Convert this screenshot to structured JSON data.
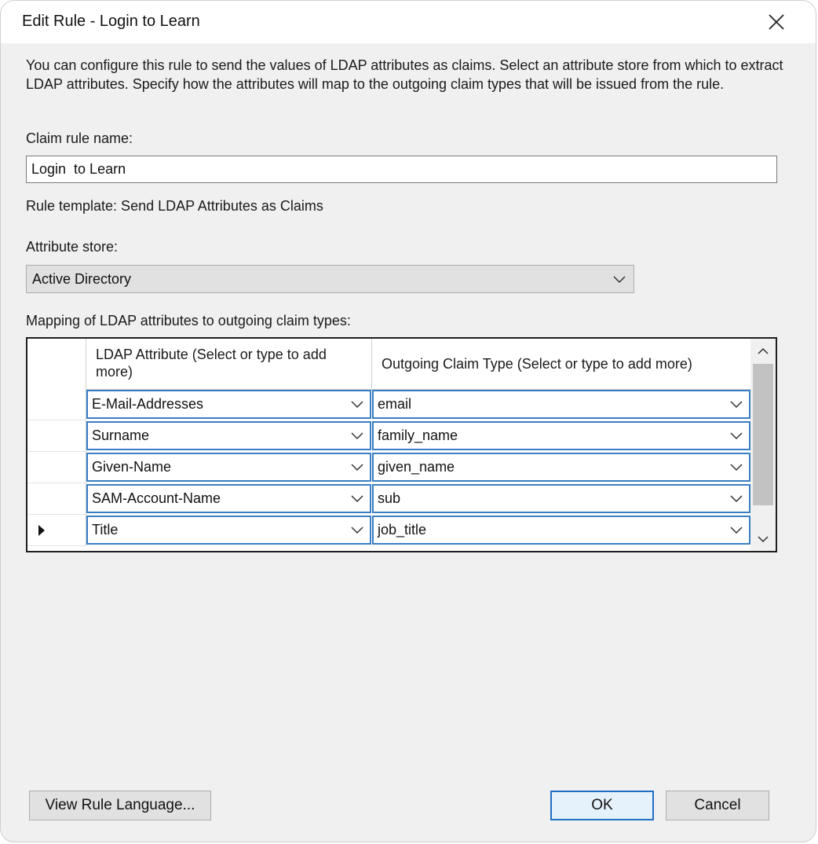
{
  "window": {
    "title": "Edit Rule - Login  to Learn",
    "close_icon": "close-icon"
  },
  "description": "You can configure this rule to send the values of LDAP attributes as claims. Select an attribute store from which to extract LDAP attributes. Specify how the attributes will map to the outgoing claim types that will be issued from the rule.",
  "claim_rule_name": {
    "label": "Claim rule name:",
    "value": "Login  to Learn"
  },
  "rule_template": "Rule template: Send LDAP Attributes as Claims",
  "attribute_store": {
    "label": "Attribute store:",
    "selected": "Active Directory"
  },
  "mapping": {
    "label": "Mapping of LDAP attributes to outgoing claim types:",
    "columns": [
      "LDAP Attribute (Select or type to add more)",
      "Outgoing Claim Type (Select or type to add more)"
    ],
    "rows": [
      {
        "ldap": "E-Mail-Addresses",
        "claim": "email",
        "current": false
      },
      {
        "ldap": "Surname",
        "claim": "family_name",
        "current": false
      },
      {
        "ldap": "Given-Name",
        "claim": "given_name",
        "current": false
      },
      {
        "ldap": "SAM-Account-Name",
        "claim": "sub",
        "current": false
      },
      {
        "ldap": "Title",
        "claim": "job_title",
        "current": true
      }
    ]
  },
  "buttons": {
    "view_rule_language": "View Rule Language...",
    "ok": "OK",
    "cancel": "Cancel"
  },
  "colors": {
    "accent": "#3a7fc4",
    "window_bg": "#f0f0f0",
    "button_bg": "#e1e1e1"
  }
}
